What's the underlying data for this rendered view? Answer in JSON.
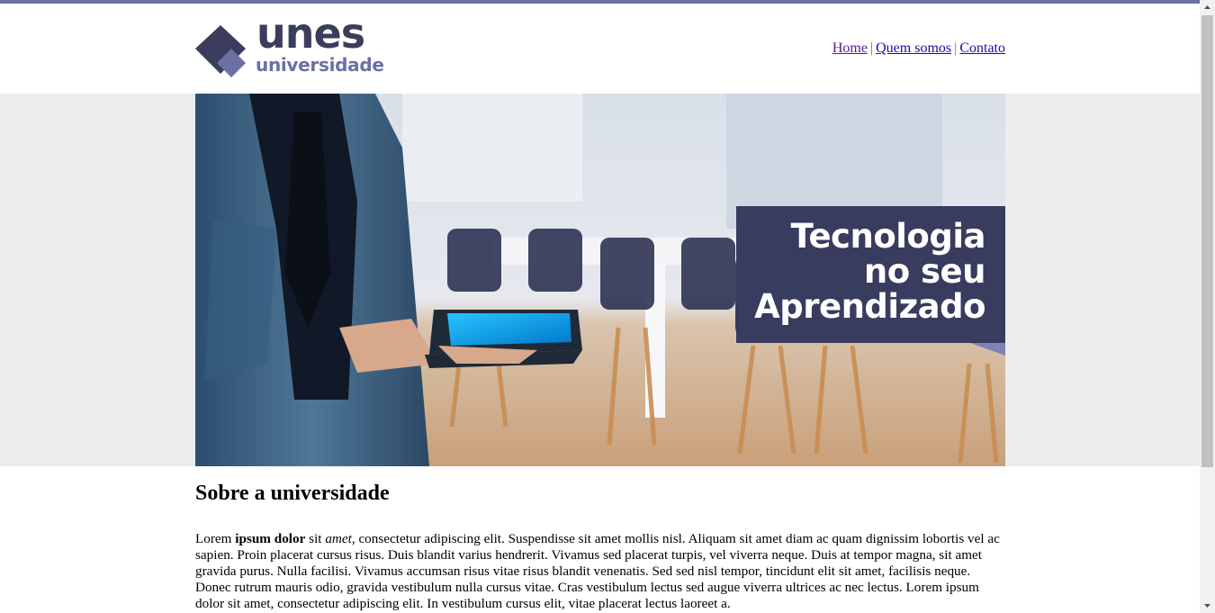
{
  "brand": {
    "name": "unes",
    "subtitle": "universidade"
  },
  "nav": {
    "items": [
      {
        "label": "Home"
      },
      {
        "label": "Quem somos"
      },
      {
        "label": "Contato"
      }
    ],
    "separator": "|"
  },
  "hero": {
    "title_lines": [
      "Tecnologia",
      "no seu",
      "Aprendizado"
    ]
  },
  "about": {
    "heading": "Sobre a universidade",
    "intro": [
      "Lorem ",
      "ipsum dolor",
      " sit ",
      "amet"
    ],
    "body": ", consectetur adipiscing elit. Suspendisse sit amet mollis nisl. Aliquam sit amet diam ac quam dignissim lobortis vel ac sapien. Proin placerat cursus risus. Duis blandit varius hendrerit. Vivamus sed placerat turpis, vel viverra neque. Duis at tempor magna, sit amet gravida purus. Nulla facilisi. Vivamus accumsan risus vitae risus blandit venenatis. Sed sed nisl tempor, tincidunt elit sit amet, facilisis neque. Donec rutrum mauris odio, gravida vestibulum nulla cursus vitae. Cras vestibulum lectus sed augue viverra ultrices ac nec lectus. Lorem ipsum dolor sit amet, consectetur adipiscing elit. In vestibulum cursus elit, vitae placerat lectus laoreet a."
  },
  "colors": {
    "accent": "#6b6fa3",
    "brand_dark": "#383c5e",
    "band": "#ededed"
  }
}
